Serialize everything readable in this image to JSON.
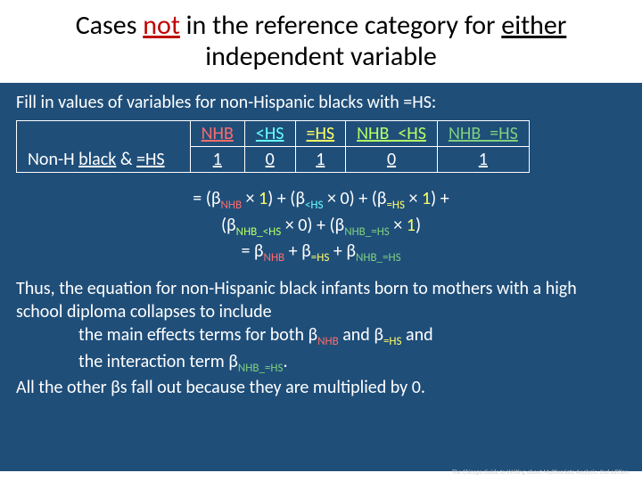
{
  "title": {
    "pre": "Cases ",
    "not": "not",
    "mid": " in the reference category for ",
    "either": "either",
    "post": " independent variable"
  },
  "fill": "Fill in values of variables for non-Hispanic blacks with =HS:",
  "table": {
    "rowlabel_pre": "Non-H ",
    "rowlabel_black": "black",
    "rowlabel_amp": " & ",
    "rowlabel_eq": "=HS",
    "cols": [
      "NHB",
      "<HS",
      "=HS",
      "NHB_<HS",
      "NHB_=HS"
    ],
    "vals": [
      "1",
      "0",
      "1",
      "0",
      "1"
    ]
  },
  "eq": {
    "l1a": "= (β",
    "l1a_sub": "NHB",
    "l1b": " × ",
    "l1_v1": "1",
    "l1c": ") + (β",
    "l1c_sub": "<HS",
    "l1d": " × ",
    "l1_v2": "0",
    "l1e": ") + (β",
    "l1e_sub": "=HS",
    "l1f": " × ",
    "l1_v3": "1",
    "l1g": ") +",
    "l2a": "(β",
    "l2a_sub": "NHB_<HS",
    "l2b": " × ",
    "l2_v1": "0",
    "l2c": ") + (β",
    "l2c_sub": "NHB_=HS",
    "l2d": " × ",
    "l2_v2": "1",
    "l2e": ")",
    "l3a": "= β",
    "l3a_sub": "NHB",
    "l3b": " + β",
    "l3b_sub": "=HS",
    "l3c": " + β",
    "l3c_sub": "NHB_=HS"
  },
  "thus": {
    "p1": "Thus, the equation for non-Hispanic black infants born to mothers with a high school diploma collapses to include",
    "b1a": "the main effects terms for both β",
    "b1a_sub": "NHB",
    "b1b": " and β",
    "b1b_sub": "=HS",
    "b1c": " and",
    "b2a": "the interaction term β",
    "b2a_sub": "NHB_=HS",
    "b2b": ".",
    "p2": "All the other βs fall out because they are multiplied by 0."
  },
  "footnote": "The Chicago Guide to Writing about Multivariate Analysis, 2nd edition."
}
